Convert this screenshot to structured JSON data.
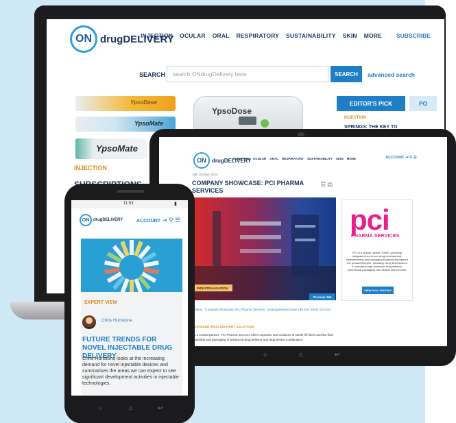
{
  "laptop": {
    "logo_on": "ON",
    "logo_text": "drugDELIVERY",
    "nav": [
      "INJECTION",
      "OCULAR",
      "ORAL",
      "RESPIRATORY",
      "SUSTAINABILITY",
      "SKIN",
      "MORE"
    ],
    "subscribe": "SUBSCRIBE",
    "search_label": "SEARCH",
    "search_placeholder": "search ONdrugDelivery here",
    "search_button": "SEARCH",
    "advanced_search": "advanced search",
    "product_labels": [
      "YpsoDose",
      "YpsoMate",
      "YpsoMate"
    ],
    "device_label": "YpsoDose",
    "tabs": [
      "EDITOR'S PICK",
      "PO"
    ],
    "editor_category": "INJECTION",
    "editor_headline": "SPRINGS: THE KEY TO",
    "category": "INJECTION",
    "headline_partial": "SUBSCRIPTIONS"
  },
  "tablet": {
    "logo_on": "ON",
    "logo_text": "drugDELIVERY",
    "nav": [
      "INJECTION",
      "OCULAR",
      "ORAL",
      "RESPIRATORY",
      "SUSTAINABILITY",
      "SKIN",
      "MORE"
    ],
    "account": "ACCOUNT",
    "date": "15th October 2024",
    "title": "COMPANY SHOWCASE: PCI PHARMA SERVICES",
    "hero_badge": "INDUSTRIALISATION",
    "issue_button": "To Issue 166",
    "pci_logo": "pci",
    "pci_sub": "PHARMA SERVICES",
    "pci_desc": "PCI is a unique, global CDMO, providing integrated end-to-end drug development, manufacturing and packaging solutions throughout the product lifecycle, including: drug development & manufacturing; advanced drug delivery; commercial packaging; and clinical trial services.",
    "profile_button": "VIEW FULL PROFILE",
    "citation": "Citation: \"Company Showcase: PCI Pharma Services\" ONdrugDelivery Issue 166 (Oct 2024) 222-224.",
    "section": "ADVANCED DRUG DELIVERY SOLUTIONS",
    "body": "As a trusted partner, PCI Pharma Services offers expertise and solutions in sterile fill-finish and the final assembly and packaging of advanced drug delivery and drug-device combination"
  },
  "phone": {
    "time": "11:53",
    "logo_on": "ON",
    "logo_text": "drugDELIVERY",
    "account": "ACCOUNT",
    "label": "EXPERT VIEW",
    "author": "Chris Hurlstone",
    "headline": "FUTURE TRENDS FOR NOVEL INJECTABLE DRUG DELIVERY",
    "summary": "Chris Hurlstone looks at the increasing demand for novel injectable devices and summarises the areas we can expect to see significant development activities in injectable technologies."
  },
  "colors": {
    "background": "#cfe8f6",
    "brand_blue": "#1f7fc6",
    "navy": "#1a3560",
    "orange": "#e08a1e",
    "pci_pink": "#e8208a"
  }
}
